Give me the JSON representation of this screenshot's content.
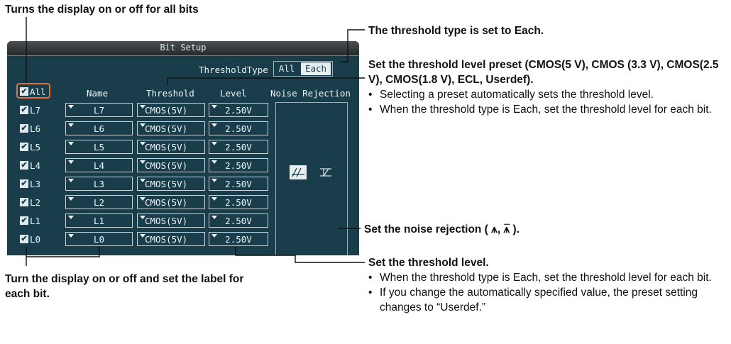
{
  "annotations": {
    "top_left": "Turns the display on or off for all bits",
    "threshold_type": "The threshold type is set to Each.",
    "preset_title": "Set the threshold level preset (CMOS(5 V), CMOS (3.3 V), CMOS(2.5 V), CMOS(1.8 V), ECL, Userdef).",
    "preset_bullets": [
      "Selecting a preset automatically sets the threshold level.",
      "When the threshold type is Each, set the threshold level for each bit."
    ],
    "noise_rejection": "Set the noise rejection ( ⩚, ⩚̅ ).",
    "level_title": "Set the threshold level.",
    "level_bullets": [
      "When the threshold type is Each, set the threshold level for each bit.",
      "If you change the automatically specified value, the preset setting changes to “Userdef.”"
    ],
    "bottom_left": "Turn the display on or off and set the label for each bit."
  },
  "dialog": {
    "title": "Bit Setup",
    "threshold_type_label": "ThresholdType",
    "threshold_type_options": [
      "All",
      "Each"
    ],
    "threshold_type_selected": "Each",
    "all_label": "All",
    "columns": {
      "name": "Name",
      "threshold": "Threshold",
      "level": "Level",
      "noise": "Noise Rejection"
    },
    "rows": [
      {
        "bit": "L7",
        "name": "L7",
        "threshold": "CMOS(5V)",
        "level": "2.50V"
      },
      {
        "bit": "L6",
        "name": "L6",
        "threshold": "CMOS(5V)",
        "level": "2.50V"
      },
      {
        "bit": "L5",
        "name": "L5",
        "threshold": "CMOS(5V)",
        "level": "2.50V"
      },
      {
        "bit": "L4",
        "name": "L4",
        "threshold": "CMOS(5V)",
        "level": "2.50V"
      },
      {
        "bit": "L3",
        "name": "L3",
        "threshold": "CMOS(5V)",
        "level": "2.50V"
      },
      {
        "bit": "L2",
        "name": "L2",
        "threshold": "CMOS(5V)",
        "level": "2.50V"
      },
      {
        "bit": "L1",
        "name": "L1",
        "threshold": "CMOS(5V)",
        "level": "2.50V"
      },
      {
        "bit": "L0",
        "name": "L0",
        "threshold": "CMOS(5V)",
        "level": "2.50V"
      }
    ],
    "check_glyph": "✔"
  },
  "colors": {
    "panel": "#1a3d4c",
    "highlight": "#e0703c"
  }
}
